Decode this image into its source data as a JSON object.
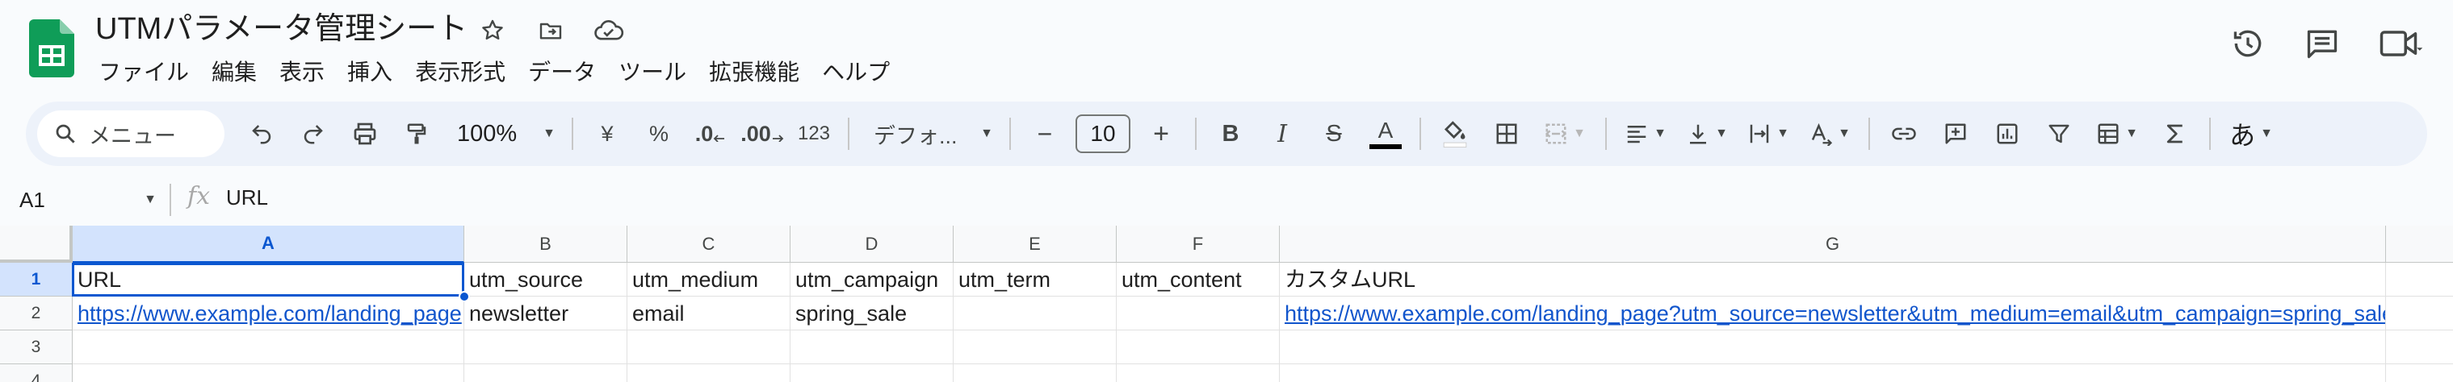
{
  "doc": {
    "title": "UTMパラメータ管理シート"
  },
  "menu": [
    "ファイル",
    "編集",
    "表示",
    "挿入",
    "表示形式",
    "データ",
    "ツール",
    "拡張機能",
    "ヘルプ"
  ],
  "toolbar": {
    "search_label": "メニュー",
    "zoom": "100%",
    "currency": "¥",
    "percent": "%",
    "decrease_decimal": ".0",
    "increase_decimal": ".00",
    "number_format": "123",
    "font": "デフォ...",
    "font_size": "10",
    "minus": "−",
    "plus": "+",
    "bold": "B",
    "italic": "I",
    "strike": "S",
    "text_color": "A",
    "input_tools": "あ"
  },
  "formula": {
    "cell_ref": "A1",
    "fx": "fx",
    "value": "URL"
  },
  "grid": {
    "columns": [
      "A",
      "B",
      "C",
      "D",
      "E",
      "F",
      "G"
    ],
    "rows": [
      "1",
      "2",
      "3",
      "4"
    ],
    "cells": {
      "A1": "URL",
      "B1": "utm_source",
      "C1": "utm_medium",
      "D1": "utm_campaign",
      "E1": "utm_term",
      "F1": "utm_content",
      "G1": "カスタムURL",
      "A2": "https://www.example.com/landing_page",
      "B2": "newsletter",
      "C2": "email",
      "D2": "spring_sale",
      "G2": "https://www.example.com/landing_page?utm_source=newsletter&utm_medium=email&utm_campaign=spring_sale"
    }
  },
  "colors": {
    "accent": "#0b57d0",
    "link": "#1155cc",
    "sheets_green": "#0f9d58",
    "toolbar_bg": "#edf2fa"
  }
}
